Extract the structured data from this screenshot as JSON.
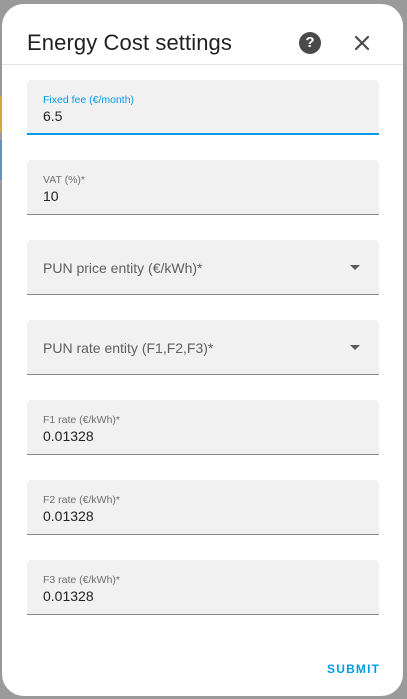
{
  "dialog": {
    "title": "Energy Cost settings",
    "help_icon": "help-circle-icon",
    "close_icon": "close-icon"
  },
  "fields": {
    "fixed_fee": {
      "label": "Fixed fee (€/month)",
      "value": "6.5"
    },
    "vat": {
      "label": "VAT (%)*",
      "value": "10"
    },
    "pun_price": {
      "label": "PUN price entity (€/kWh)*"
    },
    "pun_rate": {
      "label": "PUN rate entity (F1,F2,F3)*"
    },
    "f1_rate": {
      "label": "F1 rate (€/kWh)*",
      "value": "0.01328"
    },
    "f2_rate": {
      "label": "F2 rate (€/kWh)*",
      "value": "0.01328"
    },
    "f3_rate": {
      "label": "F3 rate (€/kWh)*",
      "value": "0.01328"
    }
  },
  "actions": {
    "submit_label": "SUBMIT"
  },
  "colors": {
    "accent": "#039be5",
    "field_bg": "#f1f1f1"
  }
}
